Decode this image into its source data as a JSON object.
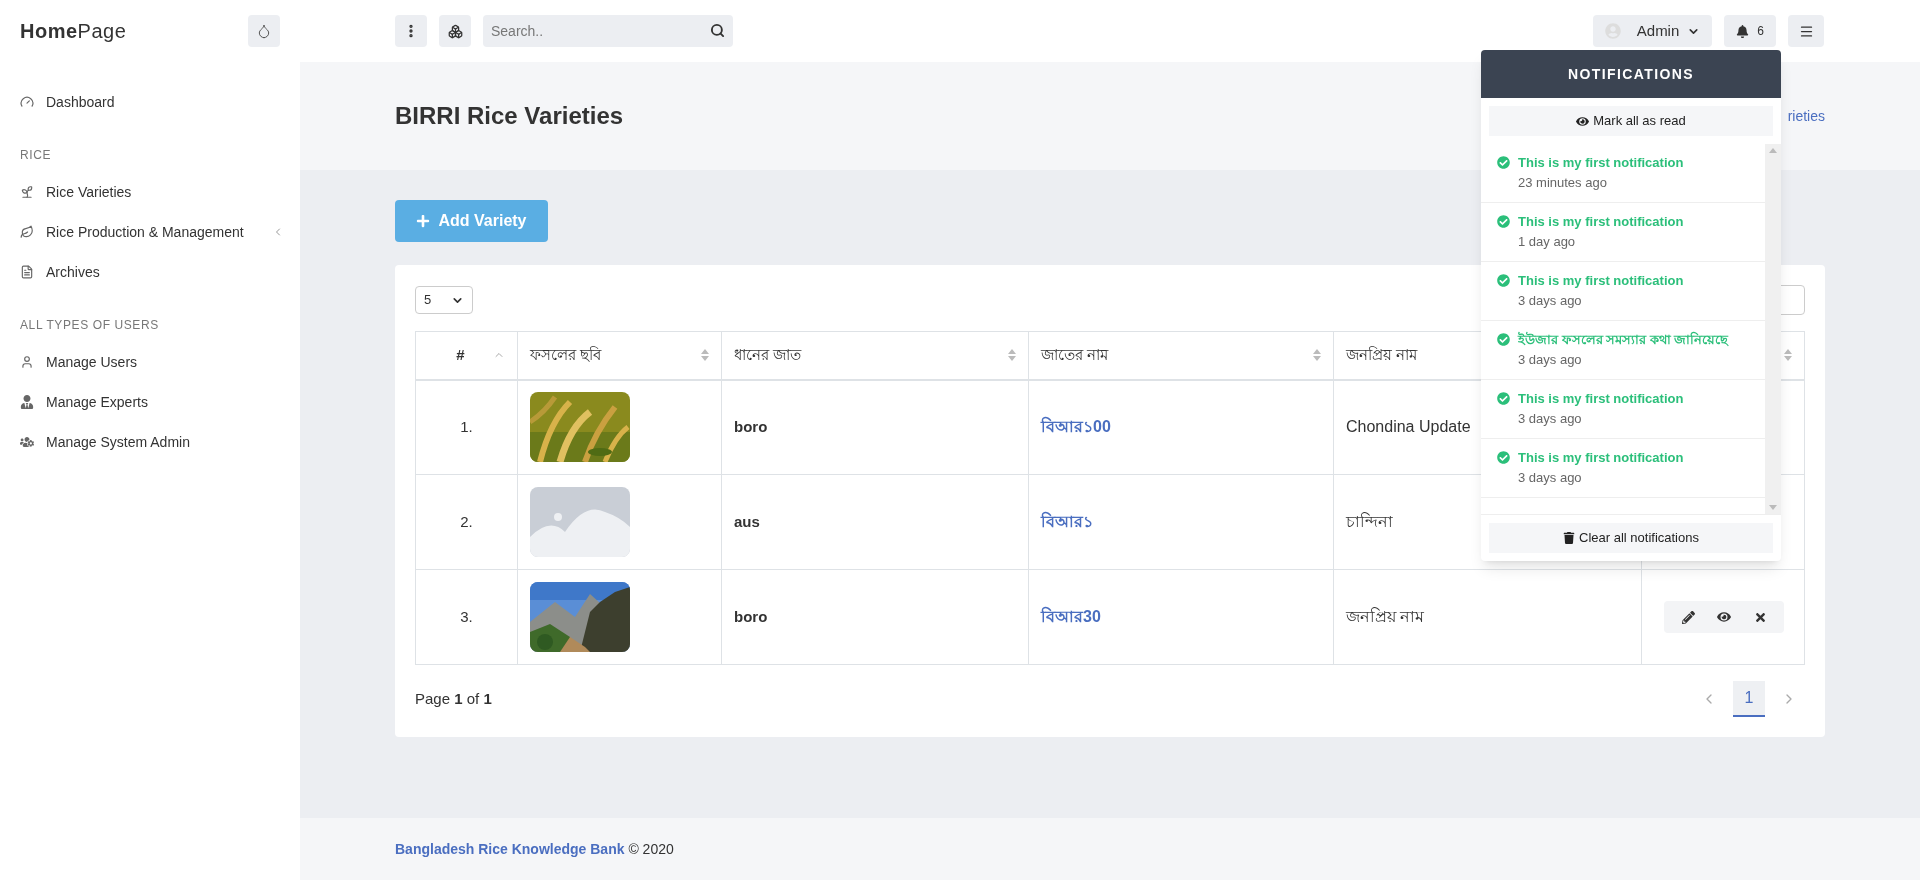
{
  "brand": {
    "bold": "Home",
    "rest": "Page"
  },
  "sidebar": {
    "sections": [
      {
        "items": [
          {
            "kind": "link",
            "label": "Dashboard"
          }
        ]
      },
      {
        "heading": "RICE",
        "items": [
          {
            "kind": "link",
            "label": "Rice Varieties"
          },
          {
            "kind": "group",
            "label": "Rice Production & Management",
            "expanded": false
          },
          {
            "kind": "link",
            "label": "Archives"
          }
        ]
      },
      {
        "heading": "ALL TYPES OF USERS",
        "items": [
          {
            "kind": "link",
            "label": "Manage Users"
          },
          {
            "kind": "link",
            "label": "Manage Experts"
          },
          {
            "kind": "link",
            "label": "Manage System Admin"
          }
        ]
      }
    ]
  },
  "topbar": {
    "search": {
      "placeholder": "Search.."
    },
    "user": "Admin",
    "notification_count": "6"
  },
  "page": {
    "title": "BIRRI Rice Varieties",
    "breadcrumb": "rieties",
    "add_button": "Add Variety"
  },
  "table": {
    "page_size": "5",
    "columns": [
      {
        "label": "#",
        "sorted": true
      },
      {
        "label": "ফসলের ছবি",
        "sorted": false
      },
      {
        "label": "ধানের জাত",
        "sorted": false
      },
      {
        "label": "জাতের নাম",
        "sorted": false
      },
      {
        "label": "জনপ্রিয় নাম"
      },
      {
        "sorted": false
      }
    ],
    "rows": [
      {
        "index": "1.",
        "type": "boro",
        "name": "বিআর১00",
        "popular": "Chondina Update",
        "show_actions": false
      },
      {
        "index": "2.",
        "image": {
          "kind": "placeholder"
        },
        "type": "aus",
        "name": "বিআর১",
        "popular": "চান্দিনা",
        "show_actions": false
      },
      {
        "index": "3.",
        "type": "boro",
        "name": "বিআর30",
        "popular": "জনপ্রিয় নাম",
        "show_actions": true
      }
    ],
    "page_info": {
      "prefix": "Page ",
      "current": "1",
      "middle": " of ",
      "total": "1"
    },
    "pages": [
      {
        "label": "1",
        "selected": true
      }
    ]
  },
  "footer": {
    "link": "Bangladesh Rice Knowledge Bank",
    "rest": " © 2020"
  },
  "notifications": {
    "title": "NOTIFICATIONS",
    "mark_all": "Mark all as read",
    "clear_all": "Clear all notifications",
    "items": [
      {
        "text": "This is my first notification",
        "time": "23 minutes ago"
      },
      {
        "text": "This is my first notification",
        "time": "1 day ago"
      },
      {
        "text": "This is my first notification",
        "time": "3 days ago"
      },
      {
        "text": "ইউজার ফসলের সমস্যার কথা জানিয়েছে",
        "time": "3 days ago"
      },
      {
        "text": "This is my first notification",
        "time": "3 days ago"
      },
      {
        "text": "This is my first notification",
        "time": "3 days ago"
      }
    ]
  }
}
